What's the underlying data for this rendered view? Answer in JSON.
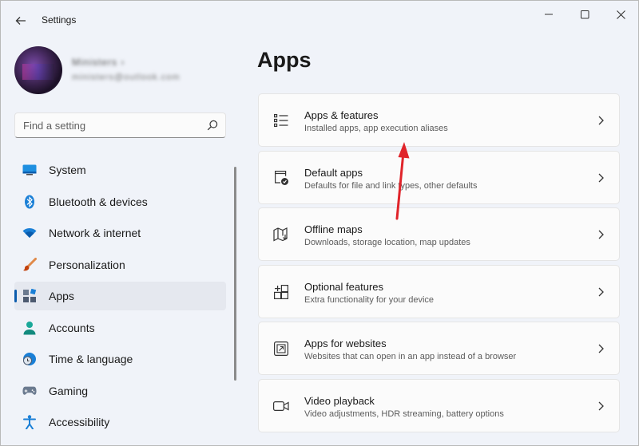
{
  "window": {
    "title": "Settings"
  },
  "profile": {
    "name": "Ministers ›",
    "email": "ministers@outlook.com"
  },
  "search": {
    "placeholder": "Find a setting"
  },
  "sidebar": {
    "items": [
      {
        "label": "System",
        "icon": "system-icon"
      },
      {
        "label": "Bluetooth & devices",
        "icon": "bluetooth-icon"
      },
      {
        "label": "Network & internet",
        "icon": "wifi-icon"
      },
      {
        "label": "Personalization",
        "icon": "brush-icon"
      },
      {
        "label": "Apps",
        "icon": "apps-icon",
        "active": true
      },
      {
        "label": "Accounts",
        "icon": "person-icon"
      },
      {
        "label": "Time & language",
        "icon": "clock-globe-icon"
      },
      {
        "label": "Gaming",
        "icon": "gamepad-icon"
      },
      {
        "label": "Accessibility",
        "icon": "accessibility-icon"
      }
    ]
  },
  "main": {
    "title": "Apps",
    "cards": [
      {
        "title": "Apps & features",
        "subtitle": "Installed apps, app execution aliases",
        "icon": "list-icon"
      },
      {
        "title": "Default apps",
        "subtitle": "Defaults for file and link types, other defaults",
        "icon": "default-apps-icon"
      },
      {
        "title": "Offline maps",
        "subtitle": "Downloads, storage location, map updates",
        "icon": "map-icon"
      },
      {
        "title": "Optional features",
        "subtitle": "Extra functionality for your device",
        "icon": "add-grid-icon"
      },
      {
        "title": "Apps for websites",
        "subtitle": "Websites that can open in an app instead of a browser",
        "icon": "open-window-icon"
      },
      {
        "title": "Video playback",
        "subtitle": "Video adjustments, HDR streaming, battery options",
        "icon": "video-icon"
      }
    ]
  },
  "colors": {
    "accent": "#0b5cad",
    "annotation_arrow": "#e0242a",
    "background": "#f0f3f9",
    "card": "#fbfbfb"
  }
}
